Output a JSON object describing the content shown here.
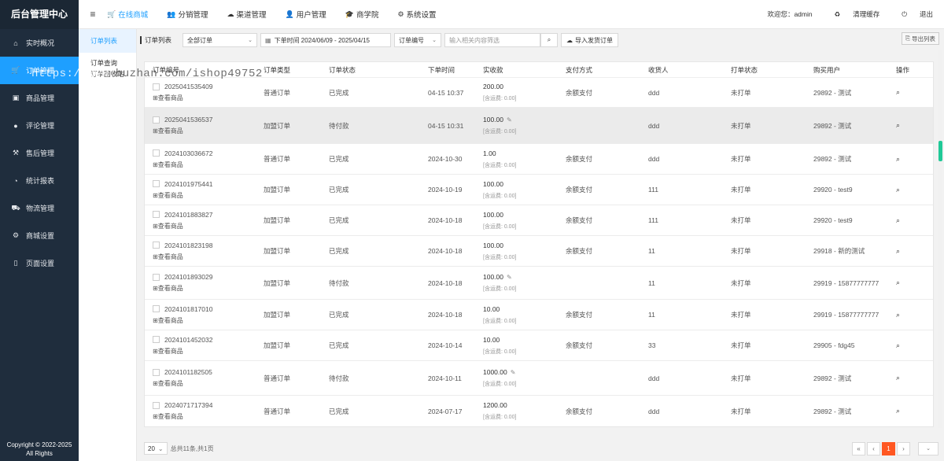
{
  "app": {
    "title": "后台管理中心",
    "copyright_line1": "Copyright © 2022-2025",
    "copyright_line2": "All Rights"
  },
  "sidebar": {
    "items": [
      {
        "label": "实时概况",
        "icon": "home-icon"
      },
      {
        "label": "订单管理",
        "icon": "cart-icon",
        "active": true
      },
      {
        "label": "商品管理",
        "icon": "package-icon"
      },
      {
        "label": "评论管理",
        "icon": "comment-icon"
      },
      {
        "label": "售后管理",
        "icon": "gavel-icon"
      },
      {
        "label": "统计报表",
        "icon": "pie-icon"
      },
      {
        "label": "物流管理",
        "icon": "truck-icon"
      },
      {
        "label": "商城设置",
        "icon": "gear-icon"
      },
      {
        "label": "页面设置",
        "icon": "file-icon"
      }
    ]
  },
  "topbar": {
    "nav": [
      {
        "label": "在线商城",
        "icon": "cart-icon",
        "active": true
      },
      {
        "label": "分销管理",
        "icon": "users-icon"
      },
      {
        "label": "渠道管理",
        "icon": "chat-icon"
      },
      {
        "label": "用户管理",
        "icon": "user-icon"
      },
      {
        "label": "商学院",
        "icon": "school-icon"
      },
      {
        "label": "系统设置",
        "icon": "gear-icon"
      }
    ],
    "welcome": "欢迎您：admin",
    "clear_cache": "清理缓存",
    "logout": "退出"
  },
  "submenu": {
    "items": [
      "订单列表",
      "订单查询",
      "订单回收站"
    ]
  },
  "toolbar": {
    "title": "订单列表",
    "status_select": "全部订单",
    "date_label": "下单时间 2024/06/09 - 2025/04/15",
    "field_select": "订单编号",
    "search_placeholder": "输入相关内容筛选",
    "import_label": "导入发货订单",
    "export_label": "导出列表"
  },
  "table": {
    "headers": [
      "订单编号",
      "订单类型",
      "订单状态",
      "下单时间",
      "实收款",
      "支付方式",
      "收货人",
      "打单状态",
      "购买用户",
      "操作"
    ],
    "view_goods": "⊞查看商品",
    "shipping_prefix": "[含运费: 0.00]",
    "rows": [
      {
        "id": "2025041535409",
        "type": "普通订单",
        "status": "已完成",
        "time": "04-15 10:37",
        "amount": "200.00",
        "editable": false,
        "pay": "余额支付",
        "receiver": "ddd",
        "print": "未打单",
        "user": "29892 - 测试"
      },
      {
        "id": "2025041536537",
        "type": "加盟订单",
        "status": "待付款",
        "time": "04-15 10:31",
        "amount": "100.00",
        "editable": true,
        "pay": "",
        "receiver": "ddd",
        "print": "未打单",
        "user": "29892 - 测试"
      },
      {
        "id": "2024103036672",
        "type": "普通订单",
        "status": "已完成",
        "time": "2024-10-30",
        "amount": "1.00",
        "editable": false,
        "pay": "余额支付",
        "receiver": "ddd",
        "print": "未打单",
        "user": "29892 - 测试"
      },
      {
        "id": "2024101975441",
        "type": "加盟订单",
        "status": "已完成",
        "time": "2024-10-19",
        "amount": "100.00",
        "editable": false,
        "pay": "余额支付",
        "receiver": "111",
        "print": "未打单",
        "user": "29920 - test9"
      },
      {
        "id": "2024101883827",
        "type": "加盟订单",
        "status": "已完成",
        "time": "2024-10-18",
        "amount": "100.00",
        "editable": false,
        "pay": "余额支付",
        "receiver": "111",
        "print": "未打单",
        "user": "29920 - test9"
      },
      {
        "id": "2024101823198",
        "type": "加盟订单",
        "status": "已完成",
        "time": "2024-10-18",
        "amount": "100.00",
        "editable": false,
        "pay": "余额支付",
        "receiver": "11",
        "print": "未打单",
        "user": "29918 - 新的测试"
      },
      {
        "id": "2024101893029",
        "type": "加盟订单",
        "status": "待付款",
        "time": "2024-10-18",
        "amount": "100.00",
        "editable": true,
        "pay": "",
        "receiver": "11",
        "print": "未打单",
        "user": "29919 - 15877777777"
      },
      {
        "id": "2024101817010",
        "type": "加盟订单",
        "status": "已完成",
        "time": "2024-10-18",
        "amount": "10.00",
        "editable": false,
        "pay": "余额支付",
        "receiver": "11",
        "print": "未打单",
        "user": "29919 - 15877777777"
      },
      {
        "id": "2024101452032",
        "type": "加盟订单",
        "status": "已完成",
        "time": "2024-10-14",
        "amount": "10.00",
        "editable": false,
        "pay": "余额支付",
        "receiver": "33",
        "print": "未打单",
        "user": "29905 - fdg45"
      },
      {
        "id": "2024101182505",
        "type": "普通订单",
        "status": "待付款",
        "time": "2024-10-11",
        "amount": "1000.00",
        "editable": true,
        "pay": "",
        "receiver": "ddd",
        "print": "未打单",
        "user": "29892 - 测试"
      },
      {
        "id": "2024071717394",
        "type": "普通订单",
        "status": "已完成",
        "time": "2024-07-17",
        "amount": "1200.00",
        "editable": false,
        "pay": "余额支付",
        "receiver": "ddd",
        "print": "未打单",
        "user": "29892 - 测试"
      }
    ]
  },
  "footer": {
    "limit": "20",
    "total": "总共11条,共1页",
    "current_page": "1"
  },
  "watermark": {
    "text_sidebar": "https://www.",
    "text_main": "huzhan.com/ishop49752"
  },
  "colors": {
    "accent": "#1e9fff",
    "sidebar_bg": "#1f2d3d",
    "page_active": "#ff5722"
  }
}
